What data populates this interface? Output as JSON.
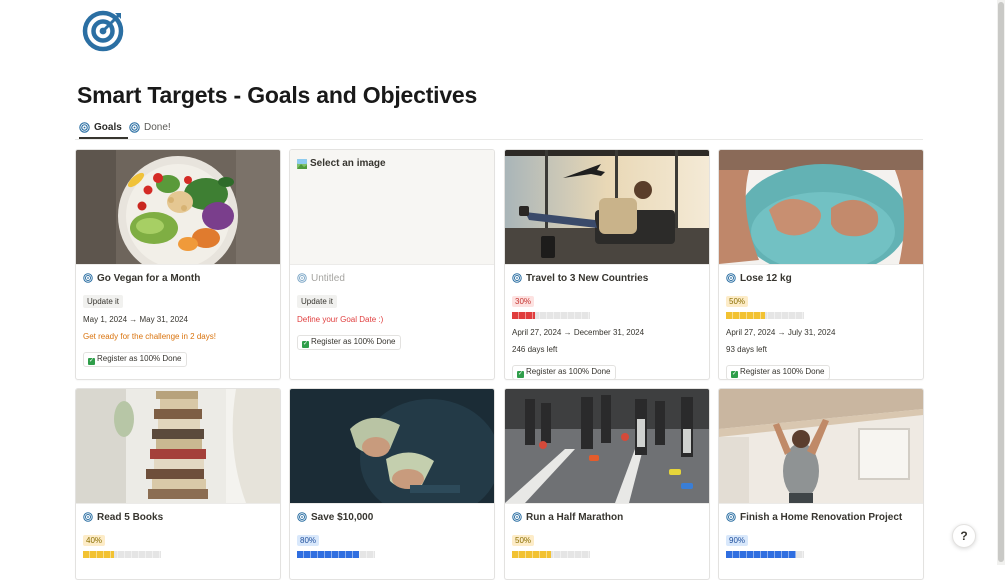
{
  "page": {
    "title": "Smart Targets - Goals and Objectives",
    "logo_icon": "target-icon"
  },
  "tabs": [
    {
      "label": "Goals",
      "icon": "target-icon",
      "active": true
    },
    {
      "label": "Done!",
      "icon": "target-icon",
      "active": false
    }
  ],
  "colors": {
    "red_bar": "#e03e3e",
    "yellow_bar": "#f2c232",
    "blue_bar": "#2f6ee0",
    "pct_red_bg": "#fde2e1",
    "pct_red_text": "#c4332f",
    "pct_yellow_bg": "#fdecc8",
    "pct_yellow_text": "#8a6e00",
    "pct_blue_bg": "#d9e8fb",
    "pct_blue_text": "#1f4f9c"
  },
  "cards": [
    {
      "title": "Go Vegan for a Month",
      "cover": "vegetable-bowl-photo",
      "update_label": "Update it",
      "dates": "May 1, 2024 → May 31, 2024",
      "note": "Get ready for the challenge in 2 days!",
      "register_label": "Register as 100% Done"
    },
    {
      "title": "Untitled",
      "cover": "empty",
      "cover_placeholder": "Select an image",
      "update_label": "Update it",
      "note": "Define your Goal Date :)",
      "register_label": "Register as 100% Done"
    },
    {
      "title": "Travel to 3 New Countries",
      "cover": "airport-traveler-photo",
      "percent_label": "30%",
      "progress": 0.3,
      "dates": "April 27, 2024 → December 31, 2024",
      "days_left": "246 days left",
      "register_label": "Register as 100% Done"
    },
    {
      "title": "Lose 12 kg",
      "cover": "belly-photo",
      "percent_label": "50%",
      "progress": 0.5,
      "dates": "April 27, 2024 → July 31, 2024",
      "days_left": "93 days left",
      "register_label": "Register as 100% Done"
    },
    {
      "title": "Read 5 Books",
      "cover": "book-stack-photo",
      "percent_label": "40%",
      "progress": 0.4
    },
    {
      "title": "Save $10,000",
      "cover": "cash-counting-photo",
      "percent_label": "80%",
      "progress": 0.8
    },
    {
      "title": "Run a Half Marathon",
      "cover": "marathon-runners-photo",
      "percent_label": "50%",
      "progress": 0.5
    },
    {
      "title": "Finish a Home Renovation Project",
      "cover": "ceiling-renovation-photo",
      "percent_label": "90%",
      "progress": 0.9
    }
  ],
  "help": {
    "label": "?"
  }
}
